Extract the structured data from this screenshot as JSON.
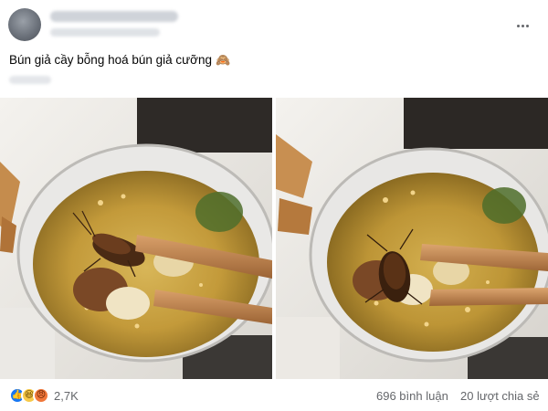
{
  "post": {
    "caption": "Bún giả cầy bỗng hoá bún giả cưỡng",
    "caption_emoji": "🙈"
  },
  "footer": {
    "reactions": [
      {
        "name": "like-icon",
        "glyph": "👍"
      },
      {
        "name": "haha-icon",
        "glyph": "😆"
      },
      {
        "name": "angry-icon",
        "glyph": "😠"
      }
    ],
    "reaction_count": "2,7K",
    "comments": "696 bình luận",
    "shares": "20 lượt chia sẻ"
  },
  "colors": {
    "text": "#050505",
    "secondary_text": "#65676b",
    "like_blue": "#1877f2",
    "broth": "#c9a64a"
  }
}
